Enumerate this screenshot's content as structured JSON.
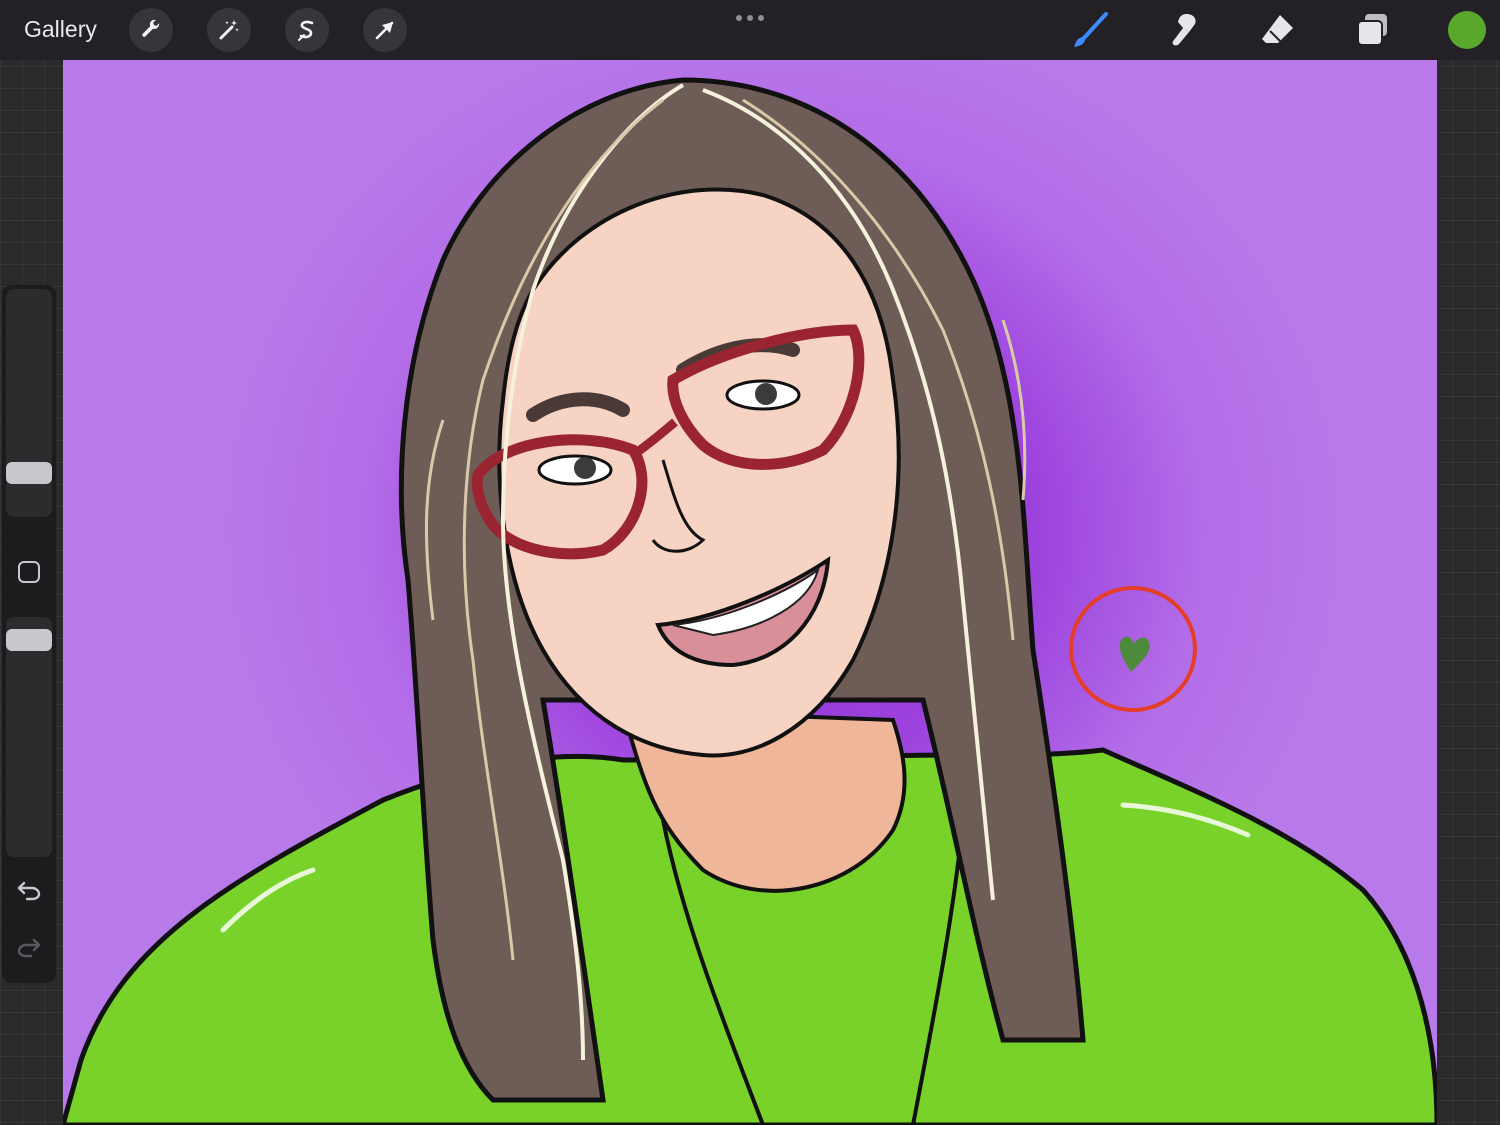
{
  "toolbar": {
    "gallery_label": "Gallery",
    "left_tools": [
      "wrench-icon",
      "magic-wand-icon",
      "selection-s-icon",
      "move-arrow-icon"
    ],
    "more_icon": "more-dots-icon",
    "right_tools": [
      "brush-icon",
      "smudge-icon",
      "eraser-icon",
      "layers-icon"
    ],
    "current_color": "#5aa82b"
  },
  "sidebar": {
    "icons": [
      "modify-square-icon",
      "undo-icon",
      "redo-icon"
    ]
  },
  "canvas": {
    "background_color": "#a658e6",
    "highlight_color": "#e43d2a"
  }
}
